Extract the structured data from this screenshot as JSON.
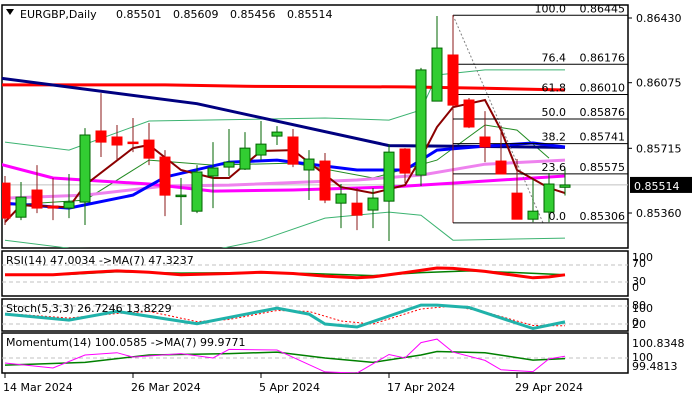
{
  "chart_data": {
    "type": "candlestick",
    "header": {
      "title": "EURGBP,Daily",
      "open": "0.85501",
      "high": "0.85609",
      "low": "0.85456",
      "close": "0.85514"
    },
    "colors": {
      "bull": "#32CD32",
      "bull_border": "#006400",
      "bear": "#FF0000",
      "bear_wick": "#8B1A1A",
      "grid": "#C0C0C0"
    },
    "candles": [
      [
        0.85524,
        0.85563,
        0.85294,
        0.85332
      ],
      [
        0.85337,
        0.8553,
        0.85321,
        0.85447
      ],
      [
        0.85486,
        0.85623,
        0.85359,
        0.85387
      ],
      [
        0.85398,
        0.85552,
        0.85321,
        0.85387
      ],
      [
        0.85387,
        0.85574,
        0.85332,
        0.8542
      ],
      [
        0.8542,
        0.85826,
        0.85294,
        0.85788
      ],
      [
        0.8581,
        0.86018,
        0.85667,
        0.85749
      ],
      [
        0.85777,
        0.85843,
        0.8565,
        0.85733
      ],
      [
        0.85749,
        0.85881,
        0.85694,
        0.85744
      ],
      [
        0.8576,
        0.85854,
        0.85623,
        0.85661
      ],
      [
        0.85667,
        0.85705,
        0.85343,
        0.85458
      ],
      [
        0.85453,
        0.85552,
        0.85294,
        0.85458
      ],
      [
        0.8537,
        0.85623,
        0.85359,
        0.85585
      ],
      [
        0.85563,
        0.85749,
        0.85387,
        0.85607
      ],
      [
        0.85612,
        0.85821,
        0.85563,
        0.85639
      ],
      [
        0.85601,
        0.85804,
        0.85596,
        0.85716
      ],
      [
        0.85678,
        0.85865,
        0.8565,
        0.85738
      ],
      [
        0.85782,
        0.85837,
        0.85733,
        0.85804
      ],
      [
        0.85777,
        0.85821,
        0.85612,
        0.85628
      ],
      [
        0.85596,
        0.85705,
        0.85431,
        0.85656
      ],
      [
        0.85645,
        0.85689,
        0.85414,
        0.85431
      ],
      [
        0.85414,
        0.85519,
        0.85277,
        0.85464
      ],
      [
        0.85414,
        0.85497,
        0.85266,
        0.85348
      ],
      [
        0.85376,
        0.85497,
        0.85277,
        0.85442
      ],
      [
        0.85425,
        0.85738,
        0.85206,
        0.85694
      ],
      [
        0.85711,
        0.85716,
        0.85524,
        0.85579
      ],
      [
        0.85568,
        0.86156,
        0.85508,
        0.86145
      ],
      [
        0.85974,
        0.86441,
        0.85974,
        0.86265
      ],
      [
        0.86227,
        0.86446,
        0.8593,
        0.85952
      ],
      [
        0.8598,
        0.85991,
        0.85826,
        0.85832
      ],
      [
        0.85777,
        0.85919,
        0.85639,
        0.85722
      ],
      [
        0.85645,
        0.85837,
        0.85574,
        0.85574
      ],
      [
        0.85469,
        0.85656,
        0.85326,
        0.85326
      ],
      [
        0.85326,
        0.85546,
        0.8531,
        0.8537
      ],
      [
        0.85365,
        0.85579,
        0.8531,
        0.85519
      ],
      [
        0.85501,
        0.85609,
        0.85456,
        0.85514
      ]
    ],
    "price_axis": {
      "ticks": [
        "0.86430",
        "0.86075",
        "0.85715",
        "0.85360"
      ],
      "current": "0.85514"
    },
    "x_labels": [
      {
        "i": 0,
        "label": "14 Mar 2024"
      },
      {
        "i": 8,
        "label": "26 Mar 2024"
      },
      {
        "i": 16,
        "label": "5 Apr 2024"
      },
      {
        "i": 24,
        "label": "17 Apr 2024"
      },
      {
        "i": 32,
        "label": "29 Apr 2024"
      }
    ],
    "overlays": [
      {
        "name": "bollinger-upper",
        "color": "#3CB371",
        "width": 1,
        "points": [
          [
            0,
            0.85749
          ],
          [
            4,
            0.85705
          ],
          [
            9,
            0.85865
          ],
          [
            20,
            0.85881
          ],
          [
            24,
            0.8587
          ],
          [
            26,
            0.85925
          ],
          [
            27,
            0.86117
          ],
          [
            30,
            0.86145
          ],
          [
            35,
            0.86145
          ]
        ]
      },
      {
        "name": "bollinger-lower",
        "color": "#3CB371",
        "width": 1,
        "points": [
          [
            0,
            0.85211
          ],
          [
            4,
            0.85167
          ],
          [
            13,
            0.85156
          ],
          [
            16,
            0.85211
          ],
          [
            20,
            0.85332
          ],
          [
            24,
            0.85365
          ],
          [
            26,
            0.85348
          ],
          [
            28,
            0.85211
          ],
          [
            35,
            0.85222
          ]
        ]
      },
      {
        "name": "bollinger-middle",
        "color": "#228B22",
        "width": 1,
        "points": [
          [
            0,
            0.85403
          ],
          [
            5,
            0.85431
          ],
          [
            9,
            0.8565
          ],
          [
            13,
            0.85623
          ],
          [
            18,
            0.85634
          ],
          [
            23,
            0.85552
          ],
          [
            27,
            0.8565
          ],
          [
            30,
            0.85843
          ],
          [
            32,
            0.85815
          ],
          [
            34,
            0.85661
          ]
        ]
      },
      {
        "name": "ma-red",
        "color": "#FF0000",
        "width": 3,
        "points": [
          [
            -0.3,
            0.86063
          ],
          [
            10,
            0.86063
          ],
          [
            15,
            0.86055
          ],
          [
            25,
            0.86052
          ],
          [
            30,
            0.86045
          ],
          [
            35,
            0.86035
          ]
        ]
      },
      {
        "name": "ma-navy",
        "color": "#000080",
        "width": 3,
        "points": [
          [
            -0.3,
            0.861
          ],
          [
            12,
            0.8596
          ],
          [
            24,
            0.8573
          ],
          [
            30,
            0.85725
          ],
          [
            35,
            0.8572
          ]
        ]
      },
      {
        "name": "ma-violet",
        "color": "#EE82EE",
        "width": 3,
        "points": [
          [
            0,
            0.85442
          ],
          [
            5,
            0.85458
          ],
          [
            10,
            0.85508
          ],
          [
            14,
            0.85513
          ],
          [
            22,
            0.85541
          ],
          [
            26,
            0.85568
          ],
          [
            30,
            0.85628
          ],
          [
            35,
            0.8565
          ]
        ]
      },
      {
        "name": "ma-magenta",
        "color": "#FF00FF",
        "width": 3,
        "points": [
          [
            -0.3,
            0.85628
          ],
          [
            3,
            0.85552
          ],
          [
            6,
            0.85535
          ],
          [
            9,
            0.85519
          ],
          [
            13,
            0.8548
          ],
          [
            18,
            0.85486
          ],
          [
            24,
            0.85502
          ],
          [
            28,
            0.85524
          ],
          [
            35,
            0.85563
          ]
        ]
      },
      {
        "name": "ma-blue",
        "color": "#0000FF",
        "width": 3,
        "points": [
          [
            0,
            0.85414
          ],
          [
            4,
            0.85387
          ],
          [
            8,
            0.85458
          ],
          [
            10,
            0.85557
          ],
          [
            14,
            0.85639
          ],
          [
            17,
            0.8565
          ],
          [
            22,
            0.85596
          ],
          [
            25,
            0.85596
          ],
          [
            27,
            0.85705
          ],
          [
            30,
            0.85727
          ],
          [
            33,
            0.85744
          ],
          [
            35,
            0.85722
          ]
        ]
      },
      {
        "name": "ma-darkred",
        "color": "#8B0000",
        "width": 2,
        "points": [
          [
            0,
            0.8531
          ],
          [
            1,
            0.85403
          ],
          [
            4,
            0.85392
          ],
          [
            5,
            0.85513
          ],
          [
            8,
            0.85716
          ],
          [
            9,
            0.85733
          ],
          [
            11,
            0.85596
          ],
          [
            13,
            0.85552
          ],
          [
            14,
            0.85552
          ],
          [
            16,
            0.857
          ],
          [
            18,
            0.85705
          ],
          [
            21,
            0.85502
          ],
          [
            23,
            0.85469
          ],
          [
            25,
            0.85513
          ],
          [
            26,
            0.85661
          ],
          [
            27,
            0.85832
          ],
          [
            28,
            0.85941
          ],
          [
            30,
            0.8598
          ],
          [
            31,
            0.85815
          ],
          [
            32,
            0.85596
          ],
          [
            34,
            0.85497
          ],
          [
            35,
            0.85469
          ]
        ]
      }
    ],
    "fibonacci": {
      "from": {
        "i": 28,
        "price": 0.86445
      },
      "to": {
        "i": 33,
        "price": 0.85306
      },
      "levels": [
        {
          "pct": "100.0",
          "price": "0.86445"
        },
        {
          "pct": "76.4",
          "price": "0.86176"
        },
        {
          "pct": "61.8",
          "price": "0.86010"
        },
        {
          "pct": "50.0",
          "price": "0.85876"
        },
        {
          "pct": "38.2",
          "price": "0.85741"
        },
        {
          "pct": "23.6",
          "price": "0.85575"
        },
        {
          "pct": "0.0",
          "price": "0.85306"
        }
      ]
    },
    "indicators": {
      "rsi": {
        "label": "RSI(14) 47.0034 ->MA(7) 47.3237",
        "levels": [
          "100",
          "70",
          "30",
          "0"
        ],
        "dashed": [
          70,
          30
        ],
        "series": [
          [
            0,
            47
          ],
          [
            3,
            47
          ],
          [
            5,
            52
          ],
          [
            7,
            56
          ],
          [
            9,
            53
          ],
          [
            11,
            47
          ],
          [
            14,
            50
          ],
          [
            16,
            53
          ],
          [
            18,
            50
          ],
          [
            20,
            44
          ],
          [
            22,
            40
          ],
          [
            23,
            42
          ],
          [
            25,
            52
          ],
          [
            27,
            63
          ],
          [
            28,
            62
          ],
          [
            30,
            55
          ],
          [
            32,
            45
          ],
          [
            33,
            40
          ],
          [
            34,
            42
          ],
          [
            35,
            47
          ]
        ],
        "ma": [
          [
            0,
            46
          ],
          [
            4,
            48
          ],
          [
            7,
            54
          ],
          [
            11,
            51
          ],
          [
            15,
            52
          ],
          [
            19,
            50
          ],
          [
            23,
            45
          ],
          [
            26,
            52
          ],
          [
            29,
            56
          ],
          [
            32,
            52
          ],
          [
            35,
            47
          ]
        ]
      },
      "stoch": {
        "label": "Stoch(5,3,3) 26.7246 13.8229",
        "levels": [
          "80",
          "100",
          "0",
          "20"
        ],
        "dashed": [
          80,
          20
        ],
        "series": [
          [
            0,
            53
          ],
          [
            4,
            33
          ],
          [
            7,
            62
          ],
          [
            12,
            21
          ],
          [
            17,
            73
          ],
          [
            19,
            53
          ],
          [
            20,
            20
          ],
          [
            22,
            10
          ],
          [
            26,
            83
          ],
          [
            27,
            83
          ],
          [
            29,
            75
          ],
          [
            33,
            5
          ],
          [
            35,
            27
          ]
        ],
        "signal": [
          [
            0,
            55
          ],
          [
            4,
            40
          ],
          [
            7,
            55
          ],
          [
            9,
            62
          ],
          [
            12,
            28
          ],
          [
            14,
            35
          ],
          [
            17,
            65
          ],
          [
            19,
            62
          ],
          [
            21,
            30
          ],
          [
            23,
            20
          ],
          [
            26,
            70
          ],
          [
            28,
            80
          ],
          [
            30,
            60
          ],
          [
            33,
            15
          ],
          [
            35,
            14
          ]
        ]
      },
      "momentum": {
        "label": "Momentum(14) 100.0585 ->MA(7) 99.9771",
        "levels": [
          "100.8348",
          "100",
          "99.4813"
        ],
        "dashed": [
          100
        ],
        "series": [
          [
            0,
            99.83
          ],
          [
            3,
            99.66
          ],
          [
            5,
            100.1
          ],
          [
            7,
            100.18
          ],
          [
            8,
            100.03
          ],
          [
            11,
            100.15
          ],
          [
            13,
            100
          ],
          [
            14,
            100.29
          ],
          [
            17,
            100.27
          ],
          [
            20,
            99.53
          ],
          [
            22,
            99.49
          ],
          [
            24,
            100.12
          ],
          [
            25,
            100
          ],
          [
            26,
            100.52
          ],
          [
            27,
            100.64
          ],
          [
            28,
            100.2
          ],
          [
            30,
            99.92
          ],
          [
            31,
            99.6
          ],
          [
            33,
            99.54
          ],
          [
            34,
            99.97
          ],
          [
            35,
            100.06
          ]
        ],
        "ma": [
          [
            0,
            99.76
          ],
          [
            5,
            99.85
          ],
          [
            9,
            100.1
          ],
          [
            14,
            100.15
          ],
          [
            17,
            100.2
          ],
          [
            20,
            100
          ],
          [
            23,
            99.85
          ],
          [
            26,
            100.1
          ],
          [
            27,
            100.22
          ],
          [
            30,
            100.18
          ],
          [
            33,
            99.93
          ],
          [
            35,
            99.98
          ]
        ]
      }
    }
  }
}
